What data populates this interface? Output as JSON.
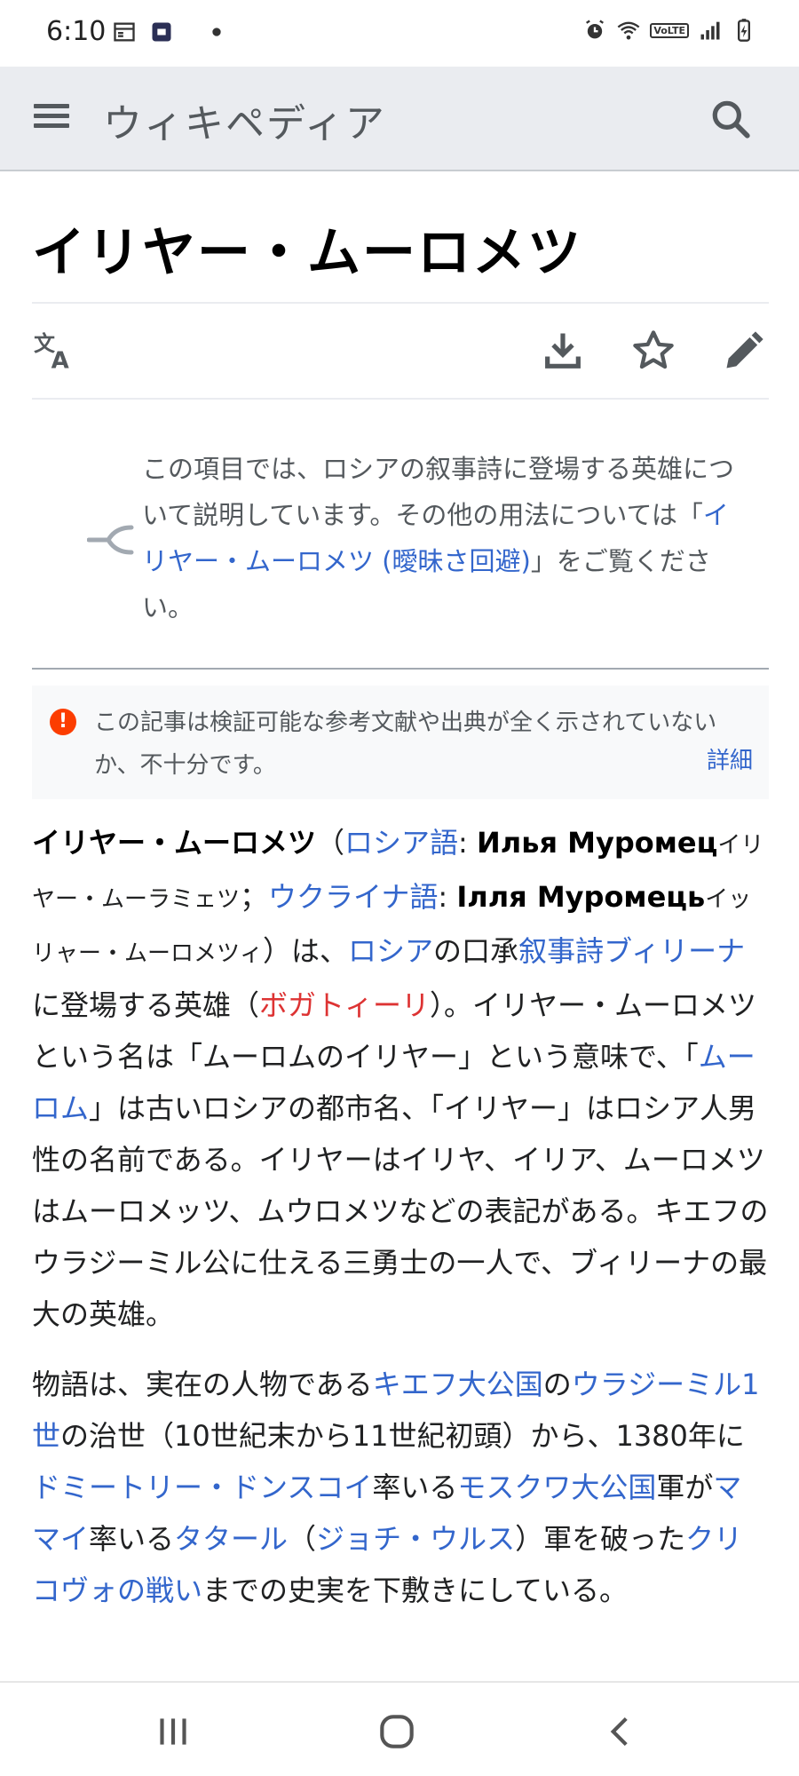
{
  "status_bar": {
    "time": "6:10",
    "left_icons": [
      "calendar-icon",
      "app-notification-icon",
      "dot-icon"
    ],
    "right_icons": [
      "alarm-icon",
      "wifi-icon",
      "volte-icon",
      "signal-icon",
      "battery-icon"
    ],
    "volte_label": "VoLTE"
  },
  "app_bar": {
    "wordmark": "ウィキペディア",
    "menu_icon": "hamburger-menu-icon",
    "search_icon": "search-icon"
  },
  "article": {
    "title": "イリヤー・ムーロメツ"
  },
  "actions": {
    "language_icon": "language-icon",
    "download_icon": "download-icon",
    "watch_icon": "star-icon",
    "edit_icon": "pencil-icon"
  },
  "hatnote": {
    "icon": "disambiguation-icon",
    "text_before": "この項目では、ロシアの叙事詩に登場する英雄について説明しています。その他の用法については「",
    "link": "イリヤー・ムーロメツ (曖昧さ回避)",
    "text_after": "」をご覧ください。"
  },
  "issue": {
    "text": "この記事は検証可能な参考文献や出典が全く示されていないか、不十分です。",
    "more": "詳細",
    "icon_symbol": "!"
  },
  "paragraph1": {
    "bold_title": "イリヤー・ムーロメツ",
    "open_paren": "（",
    "link_russian": "ロシア語",
    "colon1": ": ",
    "russian_name": "Илья Муромец",
    "russian_reading": "イリヤー・ムーラミェツ",
    "semicolon": "；",
    "link_ukrainian": "ウクライナ語",
    "colon2": ": ",
    "ukrainian_name": "Ілля Муромець",
    "ukrainian_reading": "イッリャー・ムーロメツィ",
    "close_paren_ha": "）は、",
    "link_russia": "ロシア",
    "no_oral": "の口承",
    "link_bylina": "叙事詩ブィリーナ",
    "ni_toujou": "に登場する英雄（",
    "link_bogatyr": "ボガトィーリ",
    "rest1": "）。イリヤー・ムーロメツという名は「ムーロムのイリヤー」という意味で、「",
    "link_murom": "ムーロム",
    "rest2": "」は古いロシアの都市名、「イリヤー」はロシア人男性の名前である。イリヤーはイリヤ、イリア、ムーロメツはムーロメッツ、ムウロメツなどの表記がある。キエフのウラジーミル公に仕える三勇士の一人で、ブィリーナの最大の英雄。"
  },
  "paragraph2": {
    "t1": "物語は、実在の人物である",
    "link_kievan_rus": "キエフ大公国",
    "t2": "の",
    "link_vladimir": "ウラジーミル1世",
    "t3": "の治世（10世紀末から11世紀初頭）から、1380年に",
    "link_dmitry": "ドミートリー・ドンスコイ",
    "t4": "率いる",
    "link_moscow": "モスクワ大公国",
    "t5": "軍が",
    "link_mamai": "ママイ",
    "t6": "率いる",
    "link_tatar": "タタール",
    "t7": "（",
    "link_golden_horde": "ジョチ・ウルス",
    "t8": "）軍を破った",
    "link_kulikovo": "クリコヴォの戦い",
    "t9": "までの史実を下敷きにしている。"
  },
  "nav_bar": {
    "recent_icon": "recent-apps-icon",
    "home_icon": "home-icon",
    "back_icon": "back-icon"
  },
  "colors": {
    "link": "#3366cc",
    "redlink": "#dd3333",
    "header_bg": "#eaecf0",
    "issue_icon": "#fc3d00"
  }
}
